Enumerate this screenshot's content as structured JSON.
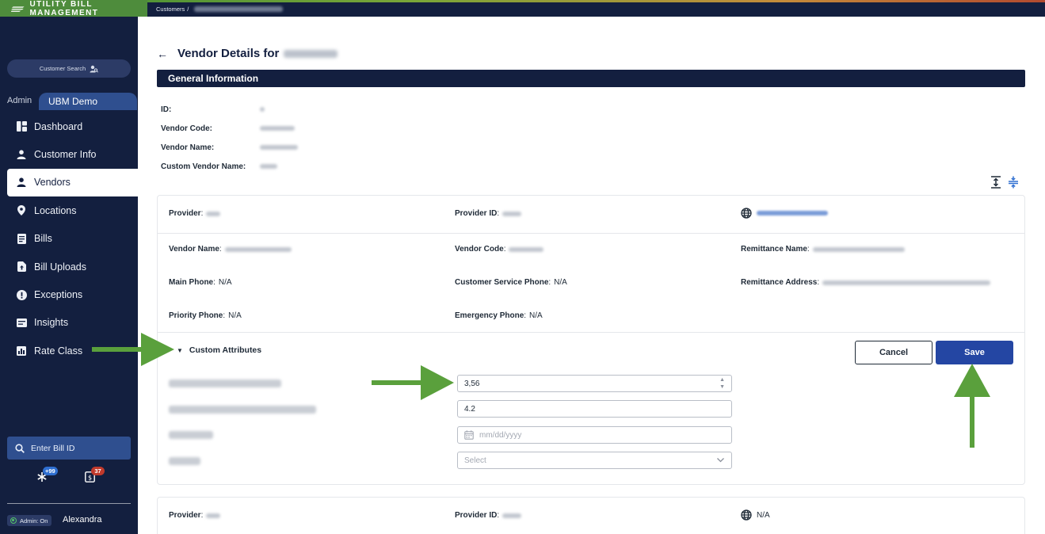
{
  "app": {
    "brand": "UTILITY BILL MANAGEMENT",
    "breadcrumb_root": "Customers",
    "breadcrumb_sep": "/"
  },
  "sidebar": {
    "customer_search": "Customer Search",
    "role_admin": "Admin",
    "role_ubm": "UBM Demo",
    "items": [
      {
        "label": "Dashboard",
        "icon": "dashboard-icon"
      },
      {
        "label": "Customer Info",
        "icon": "person-icon"
      },
      {
        "label": "Vendors",
        "icon": "person-icon",
        "active": true
      },
      {
        "label": "Locations",
        "icon": "location-pin-icon"
      },
      {
        "label": "Bills",
        "icon": "bill-icon"
      },
      {
        "label": "Bill Uploads",
        "icon": "upload-icon"
      },
      {
        "label": "Exceptions",
        "icon": "exclamation-icon"
      },
      {
        "label": "Insights",
        "icon": "insights-icon"
      },
      {
        "label": "Rate Class",
        "icon": "rate-class-icon"
      }
    ],
    "bill_id_placeholder": "Enter Bill ID",
    "notif_asterisk_count": "+99",
    "notif_bills_count": "37",
    "admin_toggle": "Admin: On",
    "user_name": "Alexandra"
  },
  "main": {
    "back_arrow": "←",
    "title_prefix": "Vendor Details for",
    "general_info_header": "General Information",
    "general_info": [
      {
        "label": "ID:"
      },
      {
        "label": "Vendor Code:"
      },
      {
        "label": "Vendor Name:"
      },
      {
        "label": "Custom Vendor Name:"
      }
    ],
    "card1": {
      "provider_label": "Provider",
      "provider_id_label": "Provider ID",
      "vendor_name_label": "Vendor Name",
      "vendor_code_label": "Vendor Code",
      "remittance_name_label": "Remittance Name",
      "main_phone_label": "Main Phone",
      "main_phone_value": "N/A",
      "cs_phone_label": "Customer Service Phone",
      "cs_phone_value": "N/A",
      "remittance_address_label": "Remittance Address",
      "priority_phone_label": "Priority Phone",
      "priority_phone_value": "N/A",
      "emergency_phone_label": "Emergency Phone",
      "emergency_phone_value": "N/A",
      "colon": ":"
    },
    "custom_attributes": {
      "toggle_label": "Custom Attributes",
      "cancel_label": "Cancel",
      "save_label": "Save",
      "fee_value": "3,56",
      "fee_percent_value": "4.2",
      "date_placeholder": "mm/dd/yyyy",
      "select_placeholder": "Select"
    },
    "card2": {
      "provider_label": "Provider",
      "provider_id_label": "Provider ID",
      "website_value": "N/A"
    }
  },
  "colors": {
    "navy": "#131f3f",
    "brand_green": "#4e8c3c",
    "accent_blue": "#2446a3",
    "annotation_green": "#5aa03c"
  }
}
